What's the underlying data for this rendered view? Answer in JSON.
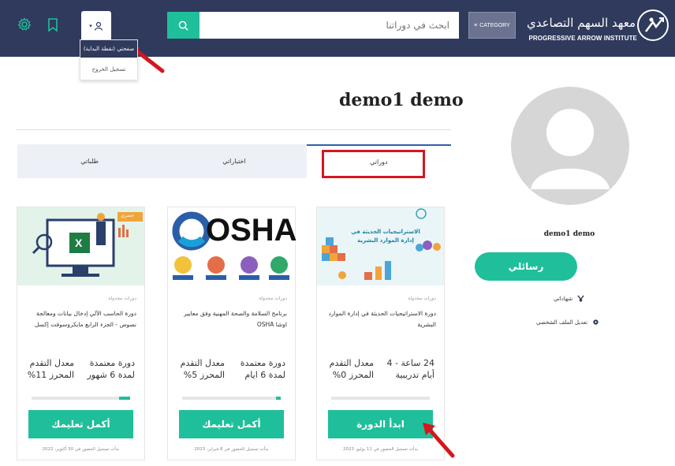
{
  "header": {
    "logo_ar": "معهد السهم التصاعدي",
    "logo_en": "PROGRESSIVE ARROW INSTITUTE",
    "category_label": "CATEGORY",
    "search_placeholder": "ابحث في دوراتنا",
    "user_menu": {
      "item1": "صفحتي (نقطة البداية)",
      "item2": "تسجيل الخروج"
    }
  },
  "profile": {
    "name": "demo1 demo",
    "side_name": "demo1 demo",
    "messages_button": "رسائلي",
    "certificates_link": "شهاداتي",
    "edit_profile_link": "تعديل الملف الشخصي"
  },
  "tabs": [
    {
      "label": "دوراتي",
      "active": true
    },
    {
      "label": "اختباراتي",
      "active": false
    },
    {
      "label": "طلباتي",
      "active": false
    }
  ],
  "cards": [
    {
      "category": "دورات مجدولة",
      "title": "دورة الاستراتيجيات الحديثة في إدارة الموارد البشرية",
      "meta_right": "24 ساعة - 4 أيام تدريبية",
      "meta_left": "معدل التقدم المحرز 0%",
      "progress": 0,
      "button": "ابدأ الدورة",
      "date": "بدأت تسجيل الحضور في 11 يوليو، 2023",
      "image_text": "الاستراتيجيات الحديثة في إدارة الموارد البشرية"
    },
    {
      "category": "دورات مجدولة",
      "title": "برنامج السلامة والصحة المهنية وفق معايير اوشا OSHA",
      "meta_right": "دورة معتمدة لمدة 6 ايام",
      "meta_left": "معدل التقدم المحرز 5%",
      "progress": 5,
      "button": "أكمل تعليمك",
      "date": "بدأت تسجيل الحضور في 8 فبراير، 2023",
      "image_text": "OSHA"
    },
    {
      "category": "دورات مجدولة",
      "title": "دورة الحاسب الآلي إدخال بيانات ومعالجة نصوص - الجزء الرابع مايكروسوفت إكسل",
      "meta_right": "دورة معتمدة لمدة 6 شهور",
      "meta_left": "معدل التقدم المحرز 11%",
      "progress": 11,
      "button": "أكمل تعليمك",
      "date": "بدأت تسجيل الحضور في 30 أكتوبر، 2022",
      "image_text": "حصري"
    }
  ],
  "colors": {
    "navy": "#2f3a5c",
    "green": "#1fbf9b",
    "red": "#d4171e"
  }
}
